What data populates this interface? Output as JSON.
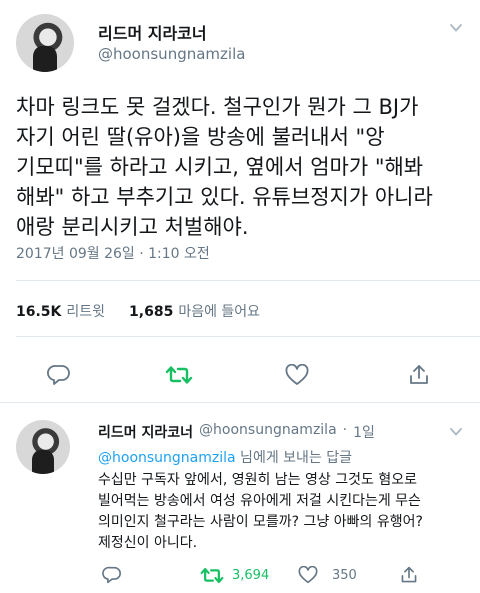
{
  "tweet": {
    "author_name": "리드머 지라코너",
    "author_handle": "@hoonsungnamzila",
    "text": "차마 링크도 못 걸겠다. 철구인가 뭔가 그 BJ가\n자기 어린 딸(유아)을 방송에 불러내서 \"앙\n기모띠\"를 하라고 시키고, 옆에서 엄마가 \"해봐\n해봐\" 하고 부추기고 있다. 유튜브정지가 아니라\n애랑 분리시키고 처벌해야.",
    "timestamp": "2017년 09월 26일 · 1:10 오전",
    "retweet_count": "16.5K",
    "retweet_label": "리트윗",
    "like_count": "1,685",
    "like_label": "마음에 들어요"
  },
  "actions": {
    "icons": [
      "reply-icon",
      "retweet-icon",
      "like-icon",
      "share-icon"
    ],
    "retweet_active_color": "#17bf63",
    "icon_color": "#657786"
  },
  "reply": {
    "author_name": "리드머 지라코너",
    "author_handle": "@hoonsungnamzila",
    "separator": "·",
    "age": "1일",
    "reply_to_handle": "@hoonsungnamzila",
    "reply_to_suffix": " 님에게 보내는 답글",
    "text": "수십만 구독자 앞에서, 영원히 남는 영상 그것도 혐오로\n빌어먹는 방송에서 여성 유아에게 저걸 시킨다는게 무슨\n의미인지 철구라는 사람이 모를까? 그냥 아빠의 유행어?\n제정신이 아니다.",
    "retweet_count": "3,694",
    "like_count": "350"
  }
}
